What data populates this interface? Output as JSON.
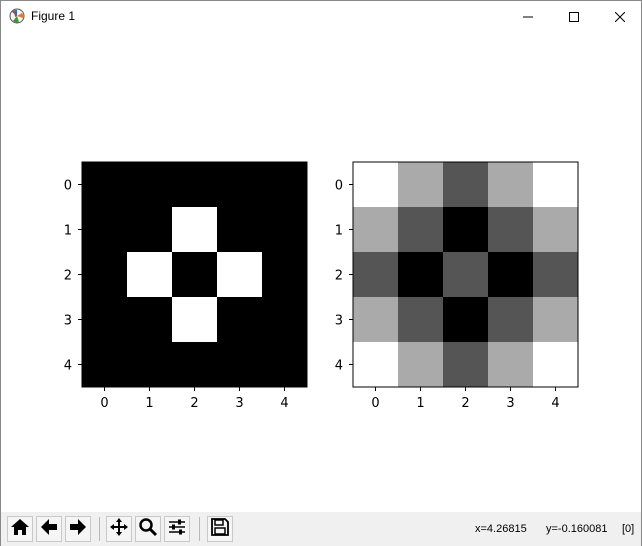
{
  "window": {
    "title": "Figure 1",
    "icons": {
      "app": "matplotlib-logo-icon",
      "minimize": "minimize-icon",
      "maximize": "maximize-icon",
      "close": "close-icon"
    }
  },
  "figure": {
    "left_image": {
      "colormap": "gray",
      "xticks": [
        "0",
        "1",
        "2",
        "3",
        "4"
      ],
      "yticks": [
        "0",
        "1",
        "2",
        "3",
        "4"
      ]
    },
    "right_image": {
      "colormap": "gray",
      "xticks": [
        "0",
        "1",
        "2",
        "3",
        "4"
      ],
      "yticks": [
        "0",
        "1",
        "2",
        "3",
        "4"
      ]
    }
  },
  "chart_data": [
    {
      "type": "heatmap",
      "colormap": "gray",
      "rows": [
        "0",
        "1",
        "2",
        "3",
        "4"
      ],
      "cols": [
        "0",
        "1",
        "2",
        "3",
        "4"
      ],
      "values": [
        [
          0,
          0,
          0,
          0,
          0
        ],
        [
          0,
          0,
          1,
          0,
          0
        ],
        [
          0,
          1,
          0,
          1,
          0
        ],
        [
          0,
          0,
          1,
          0,
          0
        ],
        [
          0,
          0,
          0,
          0,
          0
        ]
      ],
      "title": "",
      "xlabel": "",
      "ylabel": ""
    },
    {
      "type": "heatmap",
      "colormap": "gray",
      "rows": [
        "0",
        "1",
        "2",
        "3",
        "4"
      ],
      "cols": [
        "0",
        "1",
        "2",
        "3",
        "4"
      ],
      "values": [
        [
          3,
          2,
          1,
          2,
          3
        ],
        [
          2,
          1,
          0,
          1,
          2
        ],
        [
          1,
          0,
          1,
          0,
          1
        ],
        [
          2,
          1,
          0,
          1,
          2
        ],
        [
          3,
          2,
          1,
          2,
          3
        ]
      ],
      "title": "",
      "xlabel": "",
      "ylabel": ""
    }
  ],
  "toolbar": {
    "buttons": [
      {
        "name": "home-button",
        "icon": "home-icon"
      },
      {
        "name": "back-button",
        "icon": "back-arrow-icon"
      },
      {
        "name": "forward-button",
        "icon": "forward-arrow-icon"
      },
      {
        "name": "pan-button",
        "icon": "move-icon"
      },
      {
        "name": "zoom-button",
        "icon": "magnifier-icon"
      },
      {
        "name": "configure-subplots-button",
        "icon": "sliders-icon"
      },
      {
        "name": "save-button",
        "icon": "floppy-disk-icon"
      }
    ],
    "x_readout": "x=4.26815",
    "y_readout": "y=-0.160081",
    "value_readout": "[0]"
  }
}
